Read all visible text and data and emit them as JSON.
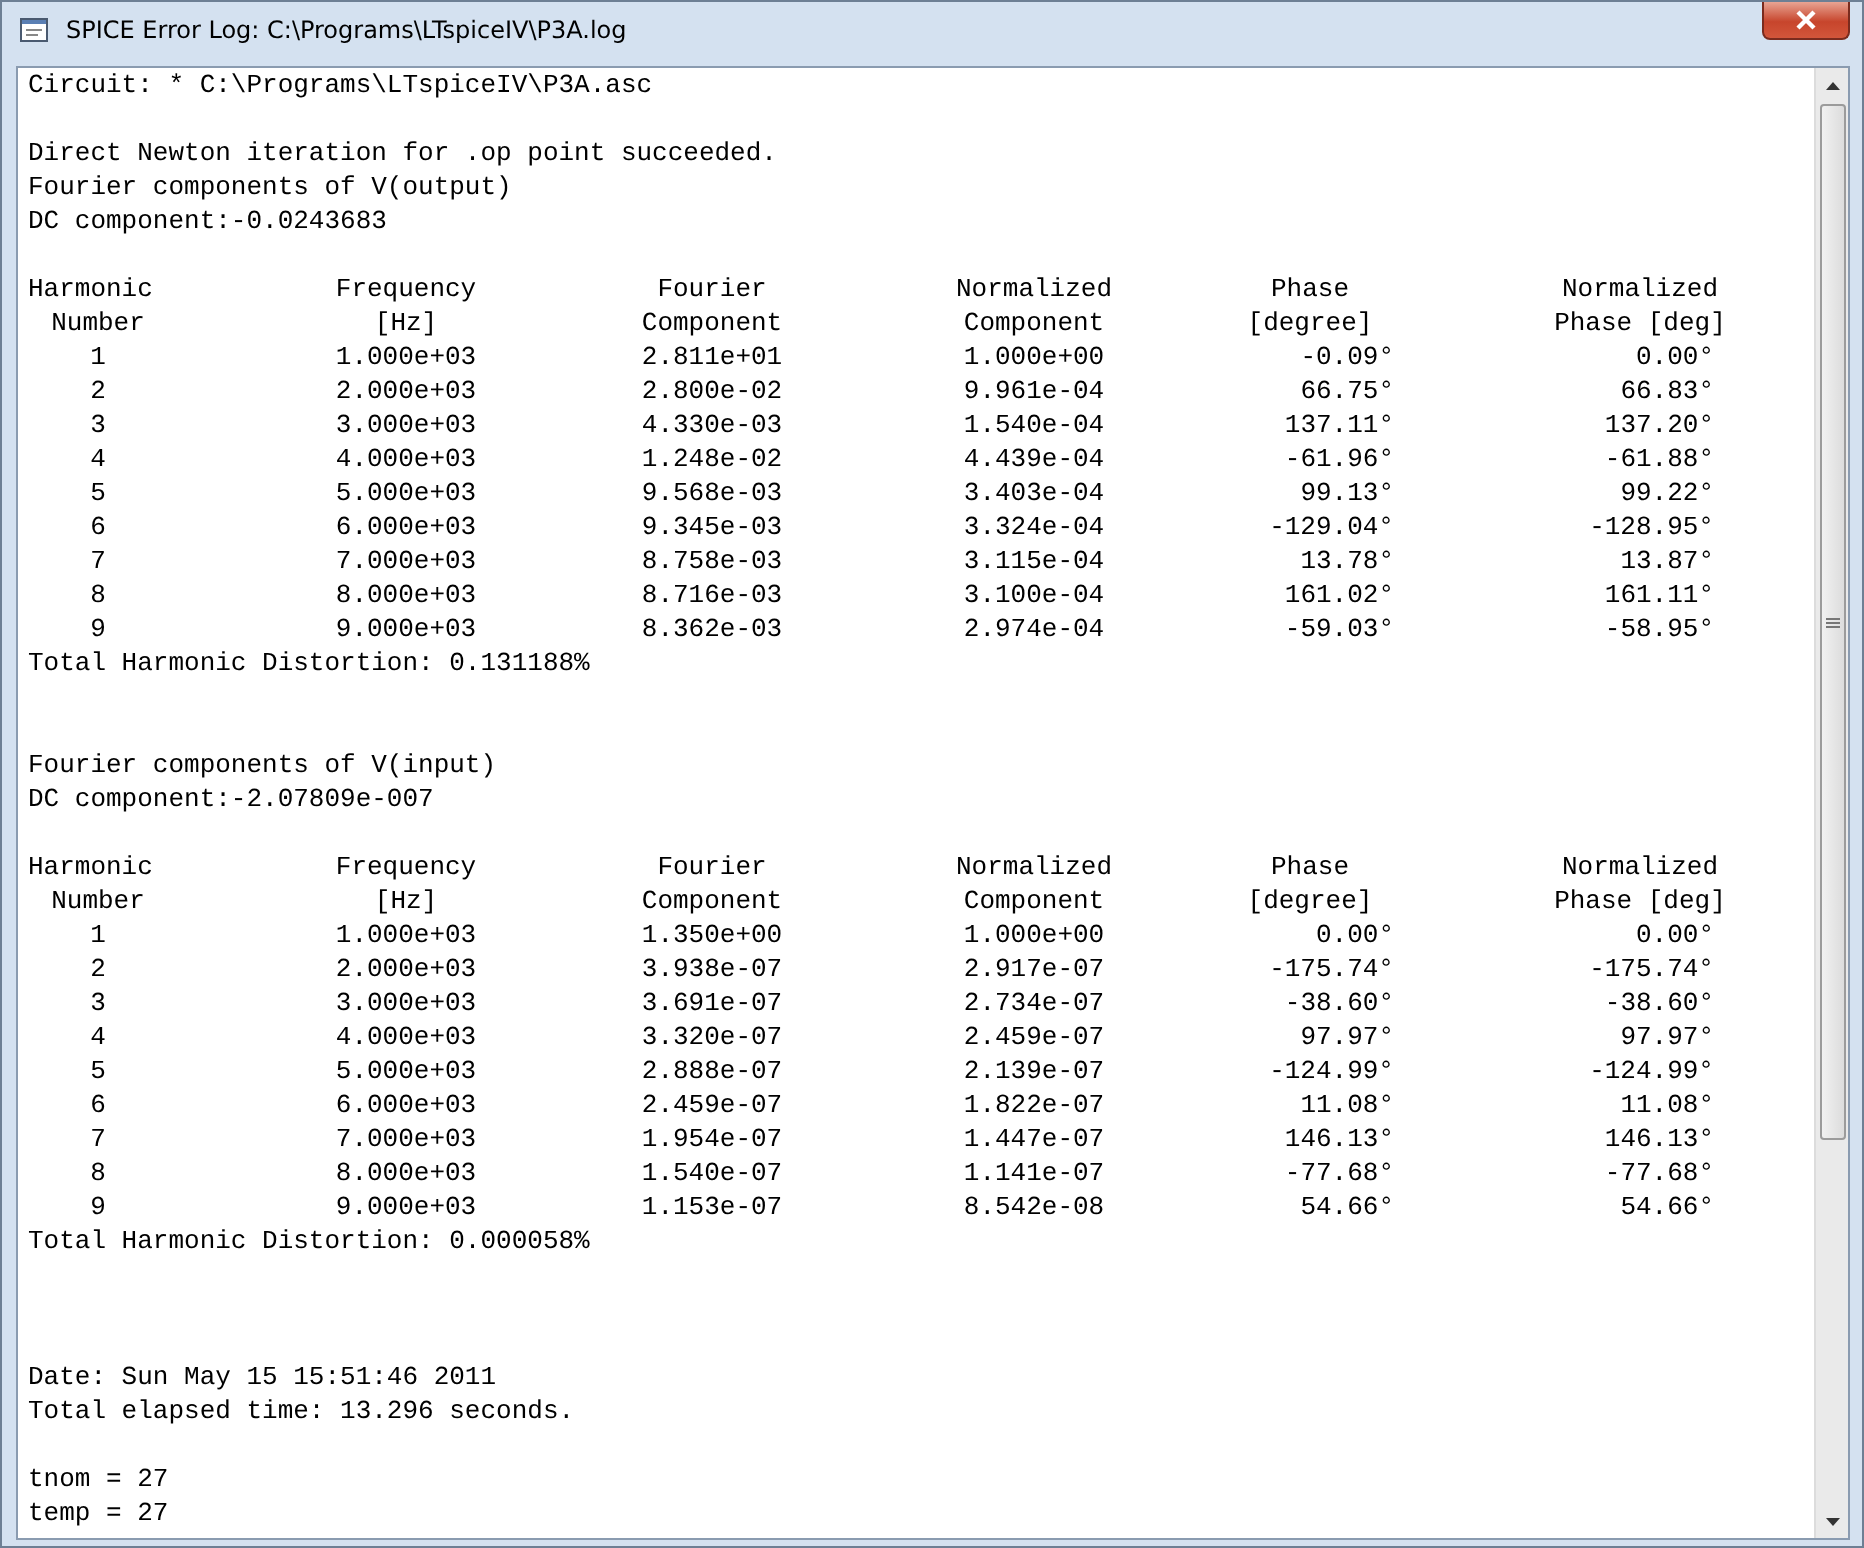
{
  "window": {
    "title": "SPICE Error Log: C:\\Programs\\LTspiceIV\\P3A.log"
  },
  "log": [
    {
      "kind": "text",
      "text": "Circuit: * C:\\Programs\\LTspiceIV\\P3A.asc"
    },
    {
      "kind": "blank"
    },
    {
      "kind": "text",
      "text": "Direct Newton iteration for .op point succeeded."
    },
    {
      "kind": "text",
      "text": "Fourier components of V(output)"
    },
    {
      "kind": "text",
      "text": "DC component:-0.0243683"
    },
    {
      "kind": "blank"
    },
    {
      "kind": "table",
      "header": [
        [
          "Harmonic",
          "Frequency",
          "Fourier",
          "Normalized",
          "Phase",
          "Normalized"
        ],
        [
          "Number",
          "[Hz]",
          "Component",
          "Component",
          "[degree]",
          "Phase [deg]"
        ]
      ],
      "rows": [
        [
          "1",
          "1.000e+03",
          "2.811e+01",
          "1.000e+00",
          "-0.09°",
          "0.00°"
        ],
        [
          "2",
          "2.000e+03",
          "2.800e-02",
          "9.961e-04",
          "66.75°",
          "66.83°"
        ],
        [
          "3",
          "3.000e+03",
          "4.330e-03",
          "1.540e-04",
          "137.11°",
          "137.20°"
        ],
        [
          "4",
          "4.000e+03",
          "1.248e-02",
          "4.439e-04",
          "-61.96°",
          "-61.88°"
        ],
        [
          "5",
          "5.000e+03",
          "9.568e-03",
          "3.403e-04",
          "99.13°",
          "99.22°"
        ],
        [
          "6",
          "6.000e+03",
          "9.345e-03",
          "3.324e-04",
          "-129.04°",
          "-128.95°"
        ],
        [
          "7",
          "7.000e+03",
          "8.758e-03",
          "3.115e-04",
          "13.78°",
          "13.87°"
        ],
        [
          "8",
          "8.000e+03",
          "8.716e-03",
          "3.100e-04",
          "161.02°",
          "161.11°"
        ],
        [
          "9",
          "9.000e+03",
          "8.362e-03",
          "2.974e-04",
          "-59.03°",
          "-58.95°"
        ]
      ]
    },
    {
      "kind": "text",
      "text": "Total Harmonic Distortion: 0.131188%"
    },
    {
      "kind": "blank"
    },
    {
      "kind": "blank"
    },
    {
      "kind": "text",
      "text": "Fourier components of V(input)"
    },
    {
      "kind": "text",
      "text": "DC component:-2.07809e-007"
    },
    {
      "kind": "blank"
    },
    {
      "kind": "table",
      "header": [
        [
          "Harmonic",
          "Frequency",
          "Fourier",
          "Normalized",
          "Phase",
          "Normalized"
        ],
        [
          "Number",
          "[Hz]",
          "Component",
          "Component",
          "[degree]",
          "Phase [deg]"
        ]
      ],
      "rows": [
        [
          "1",
          "1.000e+03",
          "1.350e+00",
          "1.000e+00",
          "0.00°",
          "0.00°"
        ],
        [
          "2",
          "2.000e+03",
          "3.938e-07",
          "2.917e-07",
          "-175.74°",
          "-175.74°"
        ],
        [
          "3",
          "3.000e+03",
          "3.691e-07",
          "2.734e-07",
          "-38.60°",
          "-38.60°"
        ],
        [
          "4",
          "4.000e+03",
          "3.320e-07",
          "2.459e-07",
          "97.97°",
          "97.97°"
        ],
        [
          "5",
          "5.000e+03",
          "2.888e-07",
          "2.139e-07",
          "-124.99°",
          "-124.99°"
        ],
        [
          "6",
          "6.000e+03",
          "2.459e-07",
          "1.822e-07",
          "11.08°",
          "11.08°"
        ],
        [
          "7",
          "7.000e+03",
          "1.954e-07",
          "1.447e-07",
          "146.13°",
          "146.13°"
        ],
        [
          "8",
          "8.000e+03",
          "1.540e-07",
          "1.141e-07",
          "-77.68°",
          "-77.68°"
        ],
        [
          "9",
          "9.000e+03",
          "1.153e-07",
          "8.542e-08",
          "54.66°",
          "54.66°"
        ]
      ]
    },
    {
      "kind": "text",
      "text": "Total Harmonic Distortion: 0.000058%"
    },
    {
      "kind": "blank"
    },
    {
      "kind": "blank"
    },
    {
      "kind": "blank"
    },
    {
      "kind": "text",
      "text": "Date: Sun May 15 15:51:46 2011"
    },
    {
      "kind": "text",
      "text": "Total elapsed time: 13.296 seconds."
    },
    {
      "kind": "blank"
    },
    {
      "kind": "text",
      "text": "tnom = 27"
    },
    {
      "kind": "text",
      "text": "temp = 27"
    }
  ]
}
